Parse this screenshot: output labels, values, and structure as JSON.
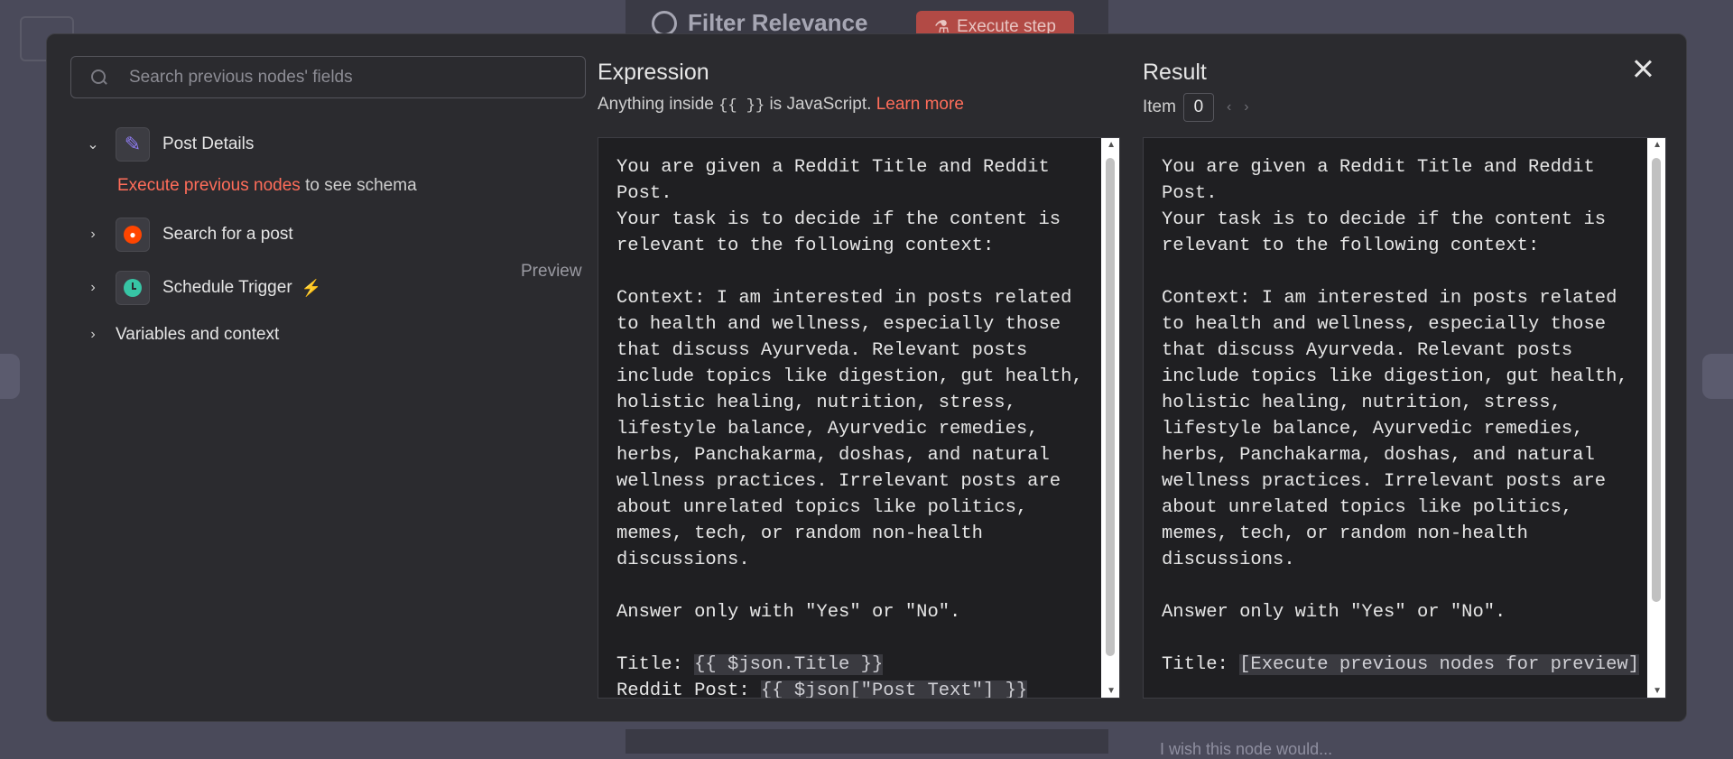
{
  "background": {
    "node_title": "Filter Relevance",
    "execute_step_label": "Execute step",
    "wish_text": "I wish this node would..."
  },
  "search": {
    "placeholder": "Search previous nodes' fields"
  },
  "tree": {
    "post_details": {
      "label": "Post Details",
      "expanded": true
    },
    "schema_note": {
      "link": "Execute previous nodes",
      "rest": " to see schema"
    },
    "search_post": {
      "label": "Search for a post",
      "preview": "Preview"
    },
    "schedule_trigger": {
      "label": "Schedule Trigger"
    },
    "variables": {
      "label": "Variables and context"
    }
  },
  "expression": {
    "title": "Expression",
    "subtitle_before": "Anything inside ",
    "subtitle_braces": "{{ }}",
    "subtitle_after": " is JavaScript. ",
    "learn_more": "Learn more",
    "body": "You are given a Reddit Title and Reddit Post.\nYour task is to decide if the content is relevant to the following context:\n\nContext: I am interested in posts related to health and wellness, especially those that discuss Ayurveda. Relevant posts include topics like digestion, gut health, holistic healing, nutrition, stress, lifestyle balance, Ayurvedic remedies, herbs, Panchakarma, doshas, and natural wellness practices. Irrelevant posts are about unrelated topics like politics, memes, tech, or random non-health discussions.\n\nAnswer only with \"Yes\" or \"No\".\n\n",
    "title_label": "Title: ",
    "title_expr": "{{ $json.Title }}",
    "post_label": "Reddit Post: ",
    "post_expr": "{{ $json[\"Post Text\"] }}"
  },
  "result": {
    "title": "Result",
    "item_label": "Item",
    "item_value": "0",
    "body": "You are given a Reddit Title and Reddit Post.\nYour task is to decide if the content is relevant to the following context:\n\nContext: I am interested in posts related to health and wellness, especially those that discuss Ayurveda. Relevant posts include topics like digestion, gut health, holistic healing, nutrition, stress, lifestyle balance, Ayurvedic remedies, herbs, Panchakarma, doshas, and natural wellness practices. Irrelevant posts are about unrelated topics like politics, memes, tech, or random non-health discussions.\n\nAnswer only with \"Yes\" or \"No\".\n\n",
    "title_label": "Title: ",
    "title_value": "[Execute previous nodes for preview]"
  },
  "colors": {
    "accent": "#ff6d5a",
    "modal_bg": "#2b2b2f",
    "editor_bg": "#1f1f22"
  }
}
